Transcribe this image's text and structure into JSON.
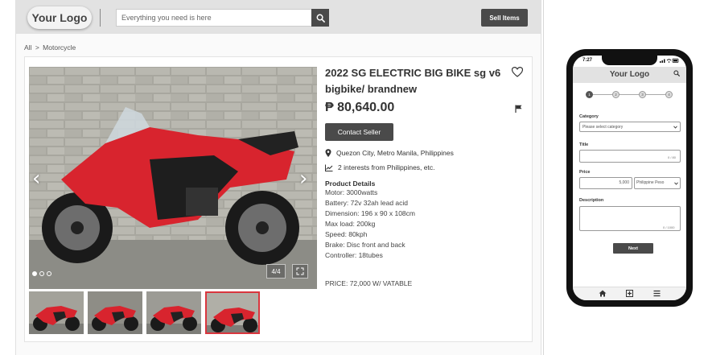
{
  "header": {
    "logo": "Your Logo",
    "search_placeholder": "Everything you need is here",
    "sell_button": "Sell Items"
  },
  "breadcrumb": [
    "All",
    ">",
    "Motorcycle"
  ],
  "listing": {
    "title": "2022 SG ELECTRIC BIG BIKE sg v6 bigbike/ brandnew",
    "price": "₱ 80,640.00",
    "contact_button": "Contact Seller",
    "location": "Quezon City, Metro Manila, Philippines",
    "interests": "2 interests from Philippines, etc.",
    "details_heading": "Product Details",
    "specs": [
      "Motor: 3000watts",
      "Battery: 72v 32ah lead acid",
      "Dimension: 196 x 90 x 108cm",
      "Max load: 200kg",
      "Speed: 80kph",
      "Brake: Disc front and back",
      "Controller: 18tubes"
    ],
    "price_note": "PRICE: 72,000 W/ VATABLE",
    "image_counter": "4/4",
    "slide_count": 3,
    "active_slide": 1,
    "thumbnail_count": 4,
    "active_thumbnail": 4
  },
  "phone": {
    "time": "7:27",
    "logo": "Your Logo",
    "steps": [
      "1",
      "2",
      "3",
      "4"
    ],
    "active_step": 1,
    "category_label": "Category",
    "category_value": "Please select category",
    "title_label": "Title",
    "title_counter": "0 / 80",
    "price_label": "Price",
    "price_value": "5,000",
    "currency": "Philippine Peso",
    "description_label": "Description",
    "description_counter": "0 / 1000",
    "next_button": "Next"
  },
  "colors": {
    "header_bg": "#e2e2e2",
    "button_dark": "#4a4a4a",
    "thumb_active_border": "#d9363e",
    "bike_red": "#d8242e"
  }
}
